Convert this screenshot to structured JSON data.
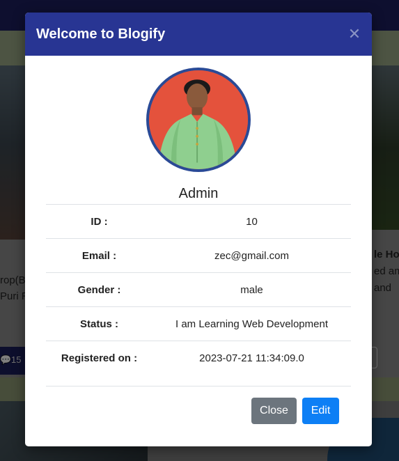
{
  "background": {
    "left_text_1": "rop(B",
    "left_text_2": "Puri R",
    "left_comments": "15",
    "right_text_1": "le Ho",
    "right_text_2": "ed am",
    "right_text_3": "and"
  },
  "modal": {
    "title": "Welcome to Blogify",
    "close_icon": "close-icon",
    "profile": {
      "name": "Admin",
      "rows": [
        {
          "label": "ID :",
          "value": "10"
        },
        {
          "label": "Email :",
          "value": "zec@gmail.com"
        },
        {
          "label": "Gender :",
          "value": "male"
        },
        {
          "label": "Status :",
          "value": "I am Learning Web Development"
        },
        {
          "label": "Registered on :",
          "value": "2023-07-21 11:34:09.0"
        }
      ]
    },
    "buttons": {
      "close": "Close",
      "edit": "Edit"
    }
  },
  "colors": {
    "header": "#283593",
    "close_button": "#6c757d",
    "edit_button": "#0d7ff5",
    "avatar_border": "#2a4a96",
    "avatar_bg": "#e4523c"
  }
}
